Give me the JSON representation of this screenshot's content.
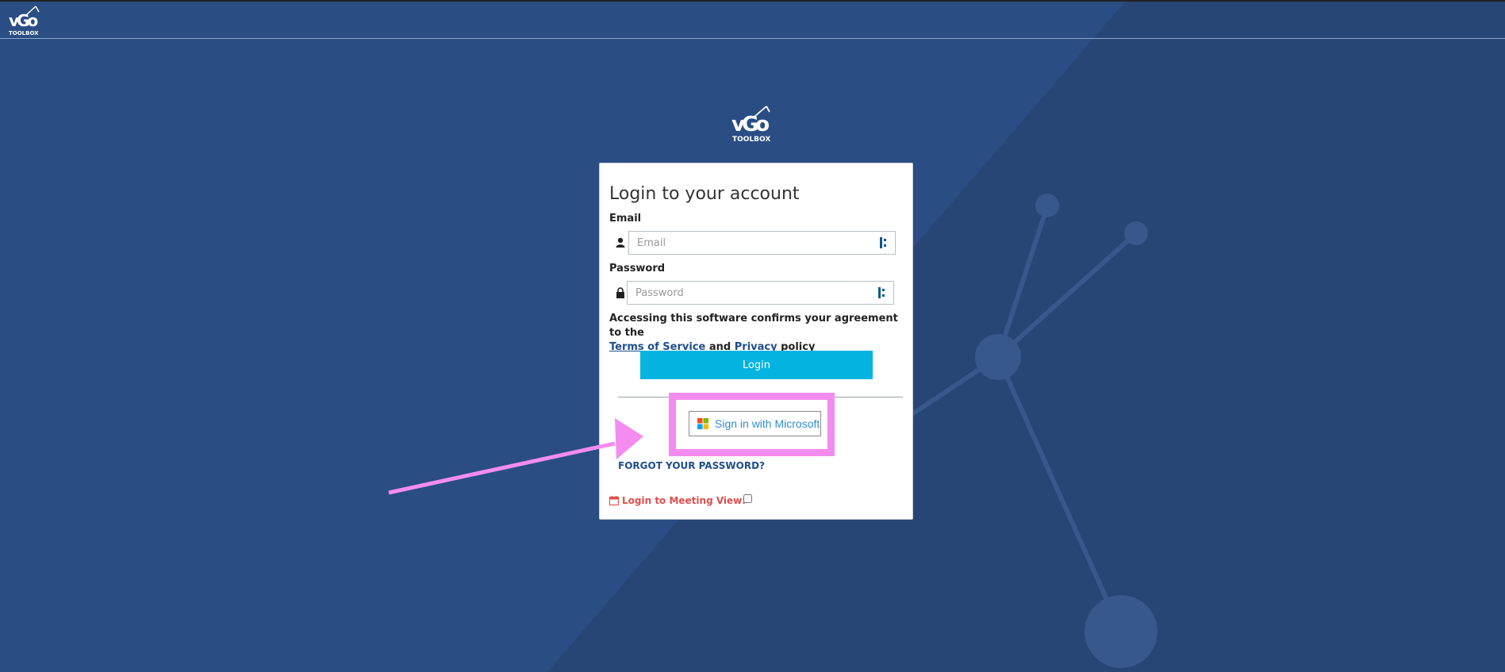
{
  "app": {
    "logo_top": "vGo TOOLBOX",
    "logo_main": "vGo TOOLBOX"
  },
  "login": {
    "title": "Login to your account",
    "email_label": "Email",
    "email_placeholder": "Email",
    "email_value": "",
    "password_label": "Password",
    "password_placeholder": "Password",
    "password_value": "",
    "agreement_prefix": "Accessing this software confirms your agreement to the",
    "terms_link": "Terms of Service",
    "and_text": "and",
    "privacy_link": "Privacy",
    "policy_text": "policy",
    "login_button": "Login",
    "microsoft_button": "Sign in with Microsoft",
    "forgot_link": "FORGOT YOUR PASSWORD?",
    "meeting_label": "Login to Meeting View:",
    "meeting_checked": false
  },
  "icons": {
    "user": "user-icon",
    "lock": "lock-icon",
    "password_manager": "password-manager-icon",
    "microsoft": "microsoft-logo-icon",
    "calendar": "calendar-icon"
  },
  "colors": {
    "background": "#2a4d84",
    "accent": "#05b3e0",
    "link": "#1f4e8c",
    "meeting": "#e04e4e",
    "highlight": "#f48cf0"
  }
}
